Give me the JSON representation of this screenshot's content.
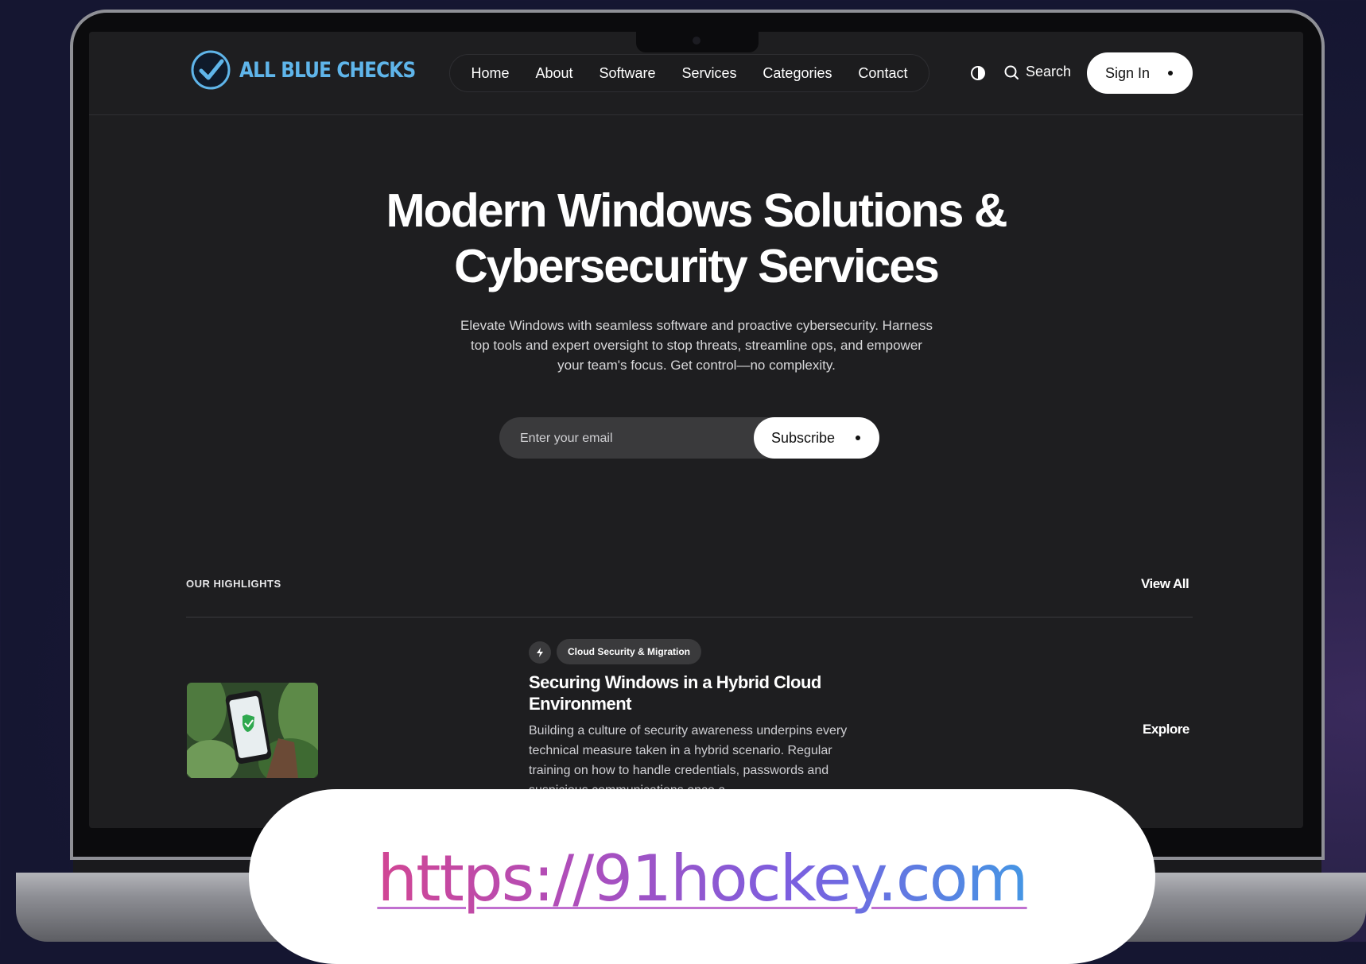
{
  "brand": {
    "name": "ALL BLUE CHECKS",
    "accent": "#5fb5ea"
  },
  "nav": {
    "items": [
      {
        "label": "Home"
      },
      {
        "label": "About"
      },
      {
        "label": "Software"
      },
      {
        "label": "Services"
      },
      {
        "label": "Categories"
      },
      {
        "label": "Contact"
      }
    ],
    "search_label": "Search",
    "signin_label": "Sign In"
  },
  "hero": {
    "title_line1": "Modern Windows Solutions &",
    "title_line2": "Cybersecurity Services",
    "description": "Elevate Windows with seamless software and proactive cybersecurity. Harness top tools and expert oversight to stop threats, streamline ops, and empower your team's focus. Get control—no complexity.",
    "email_placeholder": "Enter your email",
    "subscribe_label": "Subscribe"
  },
  "highlights": {
    "label": "OUR HIGHLIGHTS",
    "view_all": "View All",
    "article": {
      "tag": "Cloud Security & Migration",
      "title": "Securing Windows in a Hybrid Cloud Environment",
      "excerpt": "Building a culture of security awareness underpins every technical measure taken in a hybrid scenario. Regular training on how to handle credentials, passwords and suspicious communications once a",
      "explore_label": "Explore"
    }
  },
  "overlay": {
    "url": "https://91hockey.com"
  }
}
